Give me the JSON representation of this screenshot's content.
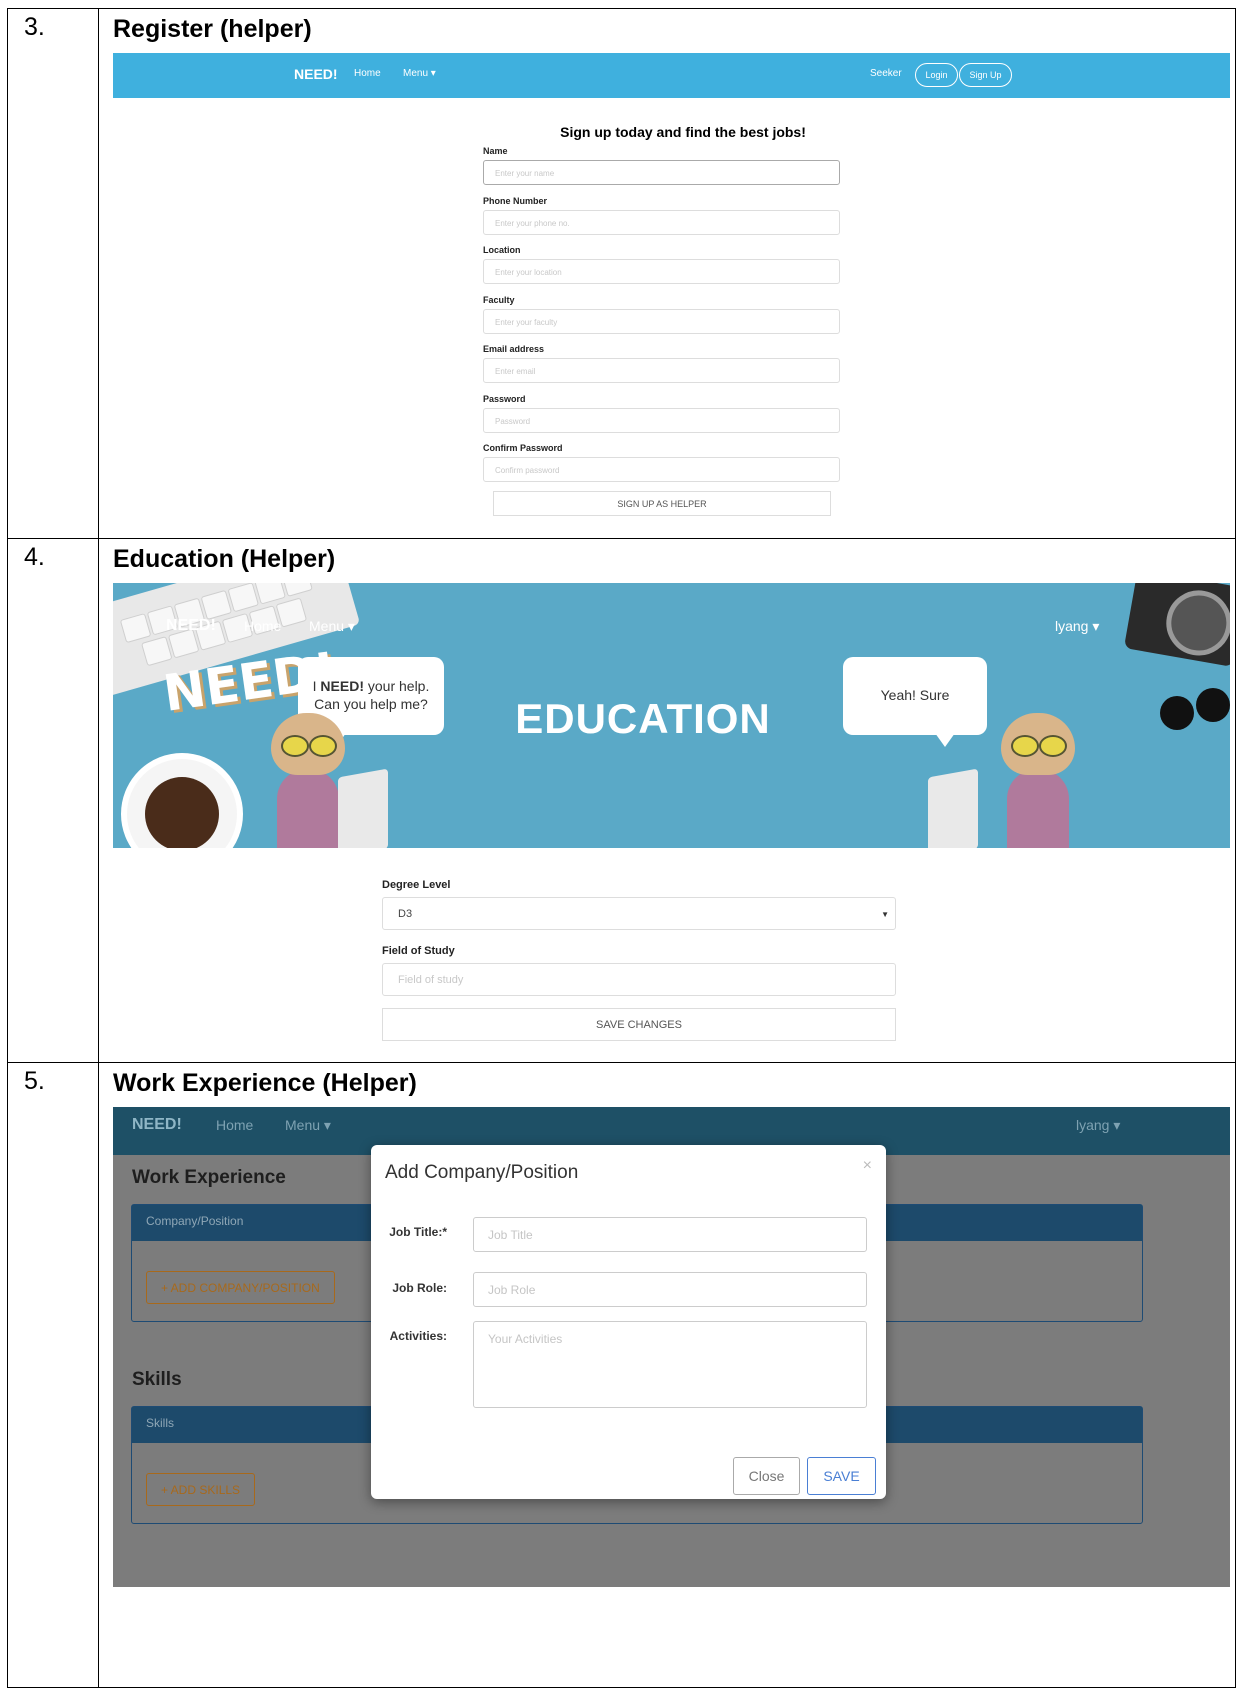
{
  "rows": [
    {
      "num": "3.",
      "title": "Register (helper)"
    },
    {
      "num": "4.",
      "title": "Education (Helper)"
    },
    {
      "num": "5.",
      "title": "Work Experience (Helper)"
    }
  ],
  "register": {
    "nav": {
      "brand": "NEED!",
      "home": "Home",
      "menu": "Menu ▾",
      "seeker": "Seeker",
      "login": "Login",
      "signup": "Sign Up"
    },
    "heading": "Sign up today and find the best jobs!",
    "fields": [
      {
        "label": "Name",
        "placeholder": "Enter your name"
      },
      {
        "label": "Phone Number",
        "placeholder": "Enter your phone no."
      },
      {
        "label": "Location",
        "placeholder": "Enter your location"
      },
      {
        "label": "Faculty",
        "placeholder": "Enter your faculty"
      },
      {
        "label": "Email address",
        "placeholder": "Enter email"
      },
      {
        "label": "Password",
        "placeholder": "Password"
      },
      {
        "label": "Confirm Password",
        "placeholder": "Confirm password"
      }
    ],
    "submit": "SIGN UP AS HELPER"
  },
  "education": {
    "nav": {
      "brand": "NEED!",
      "home": "Home",
      "menu": "Menu ▾",
      "user": "lyang ▾"
    },
    "hero_title": "EDUCATION",
    "bubble_left_bold": "NEED!",
    "bubble_left_pre": "I ",
    "bubble_left_post": " your help.",
    "bubble_left_line2": "Can you help me?",
    "bubble_right": "Yeah! Sure",
    "logo_text": "NEED!",
    "degree_label": "Degree Level",
    "degree_value": "D3",
    "field_label": "Field of Study",
    "field_placeholder": "Field of study",
    "save": "SAVE CHANGES"
  },
  "work": {
    "nav": {
      "brand": "NEED!",
      "home": "Home",
      "menu": "Menu ▾",
      "user": "lyang ▾"
    },
    "heading": "Work Experience",
    "panel_company": "Company/Position",
    "add_company": "+ ADD COMPANY/POSITION",
    "skills_heading": "Skills",
    "panel_skills": "Skills",
    "add_skills": "+ ADD SKILLS",
    "modal": {
      "title": "Add Company/Position",
      "close_x": "×",
      "job_title_label": "Job Title:*",
      "job_title_placeholder": "Job Title",
      "job_role_label": "Job Role:",
      "job_role_placeholder": "Job Role",
      "activities_label": "Activities:",
      "activities_placeholder": "Your Activities",
      "close": "Close",
      "save": "SAVE"
    }
  },
  "colors": {
    "nav_blue": "#3fb0de",
    "hero_blue": "#5aa9c7",
    "dark_nav": "#1e5066",
    "panel_blue": "#1d4a6b",
    "accent_orange": "#a8691b",
    "save_blue": "#4a7fd4"
  }
}
